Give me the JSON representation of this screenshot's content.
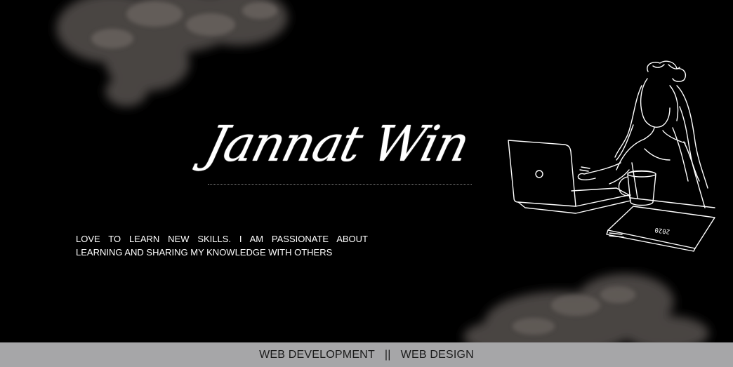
{
  "hero": {
    "signature": "Jannat Win",
    "tagline_line1": "LOVE TO LEARN NEW SKILLS. I AM PASSIONATE ABOUT",
    "tagline_line2": "LEARNING AND SHARING MY KNOWLEDGE WITH OTHERS",
    "notebook_label": "2020"
  },
  "footer": {
    "item1": "WEB DEVELOPMENT",
    "separator": "||",
    "item2": "WEB DESIGN"
  },
  "colors": {
    "background": "#000000",
    "text": "#ffffff",
    "footer_bg": "#a6a6a8",
    "footer_text": "#1a1a1a"
  },
  "icons": {
    "laptop_logo": "apple-logo-icon"
  }
}
